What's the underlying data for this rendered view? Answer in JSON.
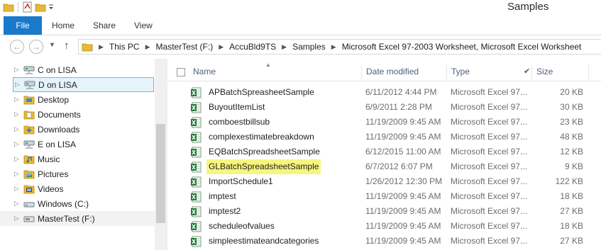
{
  "window": {
    "title": "Samples"
  },
  "ribbon": {
    "tabs": [
      "File",
      "Home",
      "Share",
      "View"
    ]
  },
  "address": {
    "crumbs": [
      "This PC",
      "MasterTest (F:)",
      "AccuBld9TS",
      "Samples",
      "Microsoft Excel 97-2003 Worksheet, Microsoft Excel Worksheet"
    ]
  },
  "nav": {
    "items": [
      {
        "label": "C on LISA",
        "icon": "network-drive-icon"
      },
      {
        "label": "D on LISA",
        "icon": "network-drive-icon",
        "selected": true
      },
      {
        "label": "Desktop",
        "icon": "folder-icon"
      },
      {
        "label": "Documents",
        "icon": "folder-icon"
      },
      {
        "label": "Downloads",
        "icon": "downloads-folder-icon"
      },
      {
        "label": "E on LISA",
        "icon": "network-drive-icon"
      },
      {
        "label": "Music",
        "icon": "music-folder-icon"
      },
      {
        "label": "Pictures",
        "icon": "pictures-folder-icon"
      },
      {
        "label": "Videos",
        "icon": "videos-folder-icon"
      },
      {
        "label": "Windows (C:)",
        "icon": "local-disk-icon"
      },
      {
        "label": "MasterTest (F:)",
        "icon": "usb-drive-icon"
      }
    ]
  },
  "columns": {
    "name": "Name",
    "date": "Date modified",
    "type": "Type",
    "size": "Size"
  },
  "files": [
    {
      "name": "APBatchSpreasheetSample",
      "date": "6/11/2012 4:44 PM",
      "type": "Microsoft Excel 97...",
      "size": "20 KB"
    },
    {
      "name": "BuyoutItemList",
      "date": "6/9/2011 2:28 PM",
      "type": "Microsoft Excel 97...",
      "size": "30 KB"
    },
    {
      "name": "comboestbillsub",
      "date": "11/19/2009 9:45 AM",
      "type": "Microsoft Excel 97...",
      "size": "23 KB"
    },
    {
      "name": "complexestimatebreakdown",
      "date": "11/19/2009 9:45 AM",
      "type": "Microsoft Excel 97...",
      "size": "48 KB"
    },
    {
      "name": "EQBatchSpreadsheetSample",
      "date": "6/12/2015 11:00 AM",
      "type": "Microsoft Excel 97...",
      "size": "12 KB"
    },
    {
      "name": "GLBatchSpreadsheetSample",
      "date": "6/7/2012 6:07 PM",
      "type": "Microsoft Excel 97...",
      "size": "9 KB",
      "highlight": true
    },
    {
      "name": "ImportSchedule1",
      "date": "1/26/2012 12:30 PM",
      "type": "Microsoft Excel 97...",
      "size": "122 KB"
    },
    {
      "name": "imptest",
      "date": "11/19/2009 9:45 AM",
      "type": "Microsoft Excel 97...",
      "size": "18 KB"
    },
    {
      "name": "imptest2",
      "date": "11/19/2009 9:45 AM",
      "type": "Microsoft Excel 97...",
      "size": "27 KB"
    },
    {
      "name": "scheduleofvalues",
      "date": "11/19/2009 9:45 AM",
      "type": "Microsoft Excel 97...",
      "size": "18 KB"
    },
    {
      "name": "simpleestimateandcategories",
      "date": "11/19/2009 9:45 AM",
      "type": "Microsoft Excel 97...",
      "size": "27 KB"
    }
  ],
  "colors": {
    "accent": "#1979ca",
    "highlight": "#f6f67e",
    "selection": "#e5f3fb"
  }
}
